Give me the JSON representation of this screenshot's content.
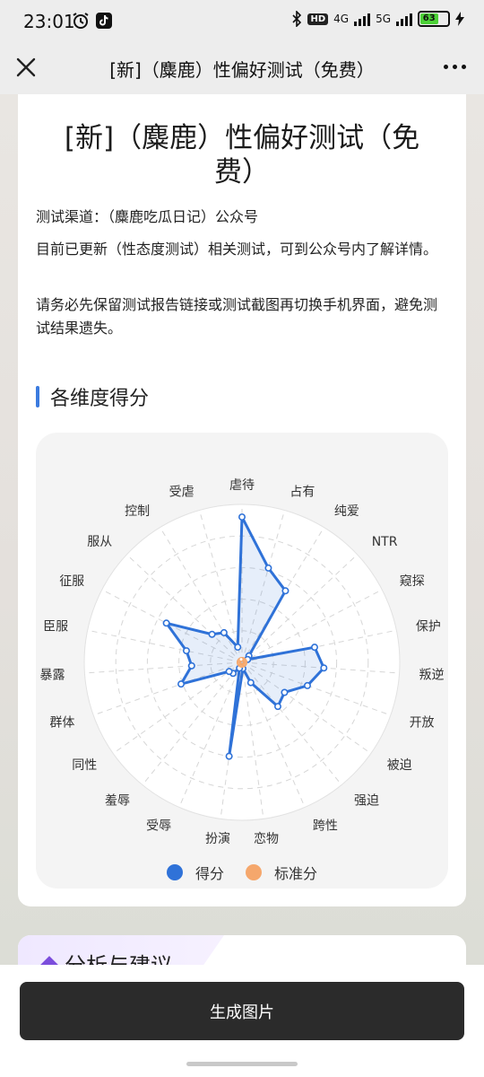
{
  "status_bar": {
    "time": "23:01",
    "network_hd": "HD",
    "network_4g": "4G",
    "network_5g": "5G",
    "battery": "63"
  },
  "nav": {
    "title": "[新]（麋鹿）性偏好测试（免费）"
  },
  "page": {
    "heading": "[新]（麋鹿）性偏好测试（免费）",
    "channel": "测试渠道：（麋鹿吃瓜日记）公众号",
    "update_note": "目前已更新（性态度测试）相关测试，可到公众号内了解详情。",
    "warning": "请务必先保留测试报告链接或测试截图再切换手机界面，避免测试结果遗失。"
  },
  "section": {
    "title": "各维度得分"
  },
  "chart_data": {
    "type": "radar",
    "categories": [
      "虐待",
      "占有",
      "纯爱",
      "NTR",
      "窥探",
      "保护",
      "叛逆",
      "开放",
      "被迫",
      "强迫",
      "跨性",
      "恋物",
      "扮演",
      "受辱",
      "羞辱",
      "同性",
      "群体",
      "暴露",
      "臣服",
      "征服",
      "服从",
      "控制",
      "受虐"
    ],
    "range": [
      0,
      100
    ],
    "series": [
      {
        "name": "得分",
        "color": "#2f72d8",
        "values": [
          92,
          62,
          53,
          6,
          4,
          47,
          52,
          44,
          33,
          36,
          14,
          4,
          60,
          4,
          9,
          10,
          41,
          32,
          36,
          54,
          26,
          22,
          10
        ]
      },
      {
        "name": "标准分",
        "color": "#f5a76c",
        "values": [
          2,
          2,
          2,
          2,
          2,
          2,
          2,
          2,
          2,
          2,
          2,
          2,
          2,
          2,
          2,
          2,
          2,
          2,
          2,
          2,
          2,
          2,
          2
        ]
      }
    ],
    "grid": true,
    "legend_position": "bottom"
  },
  "section2": {
    "title": "分析与建议"
  },
  "actions": {
    "generate_label": "生成图片"
  },
  "colors": {
    "accent": "#3b7bdf",
    "score": "#2f72d8",
    "standard": "#f5a76c"
  }
}
